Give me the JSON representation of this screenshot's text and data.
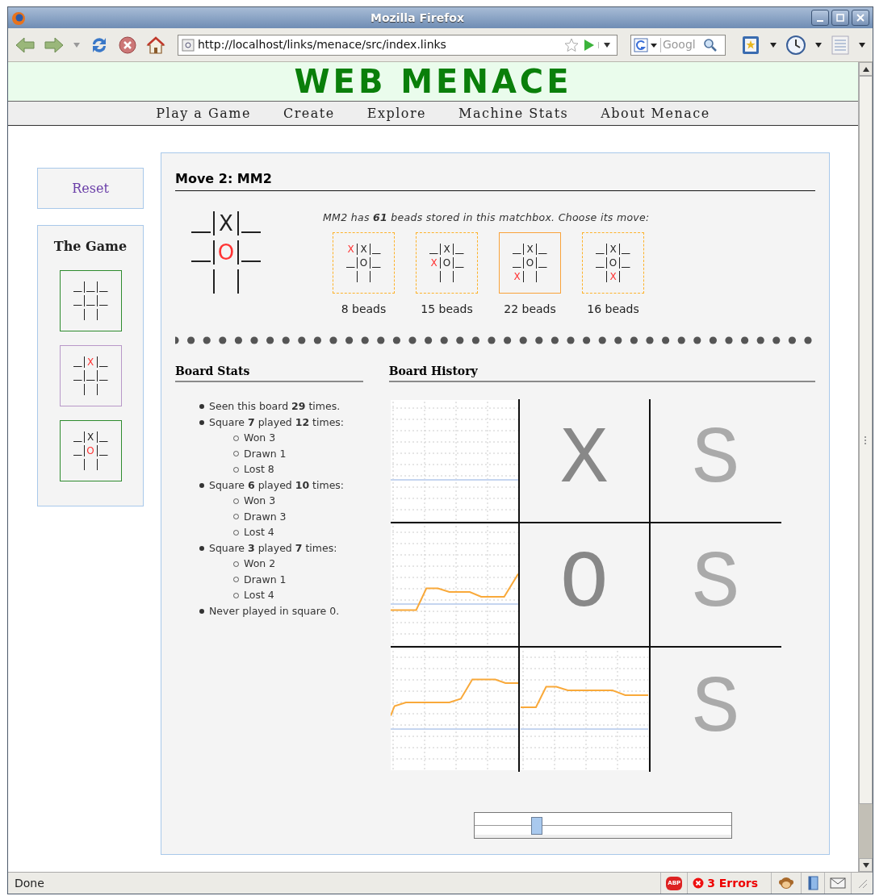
{
  "window": {
    "title": "Mozilla Firefox"
  },
  "toolbar": {
    "url": "http://localhost/links/menace/src/index.links",
    "search_placeholder": "Googl"
  },
  "page": {
    "site_title": "WEB MENACE",
    "menu": [
      "Play a Game",
      "Create",
      "Explore",
      "Machine Stats",
      "About Menace"
    ],
    "sidebar": {
      "reset_label": "Reset",
      "game_title": "The Game",
      "boards": [
        {
          "color": "#2e8b2e",
          "cells": [
            {
              "kind": "empty"
            },
            {
              "kind": "empty"
            },
            {
              "kind": "empty"
            },
            {
              "kind": "empty"
            },
            {
              "kind": "empty"
            },
            {
              "kind": "empty"
            },
            {
              "kind": "empty"
            },
            {
              "kind": "empty"
            },
            {
              "kind": "empty"
            }
          ]
        },
        {
          "color": "#b898c8",
          "cells": [
            {
              "kind": "empty"
            },
            {
              "kind": "mark",
              "mark": "X",
              "new": true
            },
            {
              "kind": "empty"
            },
            {
              "kind": "empty"
            },
            {
              "kind": "empty"
            },
            {
              "kind": "empty"
            },
            {
              "kind": "empty"
            },
            {
              "kind": "empty"
            },
            {
              "kind": "empty"
            }
          ]
        },
        {
          "color": "#2e8b2e",
          "cells": [
            {
              "kind": "empty"
            },
            {
              "kind": "mark",
              "mark": "X",
              "new": false
            },
            {
              "kind": "empty"
            },
            {
              "kind": "empty"
            },
            {
              "kind": "mark",
              "mark": "O",
              "new": true
            },
            {
              "kind": "empty"
            },
            {
              "kind": "empty"
            },
            {
              "kind": "empty"
            },
            {
              "kind": "empty"
            }
          ]
        }
      ]
    },
    "move": {
      "title": "Move 2: MM2",
      "board": {
        "cells": [
          {
            "kind": "empty"
          },
          {
            "kind": "mark",
            "mark": "X",
            "new": false
          },
          {
            "kind": "empty"
          },
          {
            "kind": "empty"
          },
          {
            "kind": "mark",
            "mark": "O",
            "new": true
          },
          {
            "kind": "empty"
          },
          {
            "kind": "empty"
          },
          {
            "kind": "empty"
          },
          {
            "kind": "empty"
          }
        ]
      },
      "prompt": "MM2 has **61** beads stored in this matchbox. Choose its move:",
      "options": [
        {
          "selected": false,
          "beads": "8 beads",
          "cells": [
            {
              "kind": "mark",
              "mark": "X",
              "new": true
            },
            {
              "kind": "mark",
              "mark": "X",
              "new": false
            },
            {
              "kind": "empty"
            },
            {
              "kind": "empty"
            },
            {
              "kind": "mark",
              "mark": "O",
              "new": false
            },
            {
              "kind": "empty"
            },
            {
              "kind": "empty"
            },
            {
              "kind": "empty"
            },
            {
              "kind": "empty"
            }
          ]
        },
        {
          "selected": false,
          "beads": "15 beads",
          "cells": [
            {
              "kind": "empty"
            },
            {
              "kind": "mark",
              "mark": "X",
              "new": false
            },
            {
              "kind": "empty"
            },
            {
              "kind": "mark",
              "mark": "X",
              "new": true
            },
            {
              "kind": "mark",
              "mark": "O",
              "new": false
            },
            {
              "kind": "empty"
            },
            {
              "kind": "empty"
            },
            {
              "kind": "empty"
            },
            {
              "kind": "empty"
            }
          ]
        },
        {
          "selected": true,
          "beads": "22 beads",
          "cells": [
            {
              "kind": "empty"
            },
            {
              "kind": "mark",
              "mark": "X",
              "new": false
            },
            {
              "kind": "empty"
            },
            {
              "kind": "empty"
            },
            {
              "kind": "mark",
              "mark": "O",
              "new": false
            },
            {
              "kind": "empty"
            },
            {
              "kind": "mark",
              "mark": "X",
              "new": true
            },
            {
              "kind": "empty"
            },
            {
              "kind": "empty"
            }
          ]
        },
        {
          "selected": false,
          "beads": "16 beads",
          "cells": [
            {
              "kind": "empty"
            },
            {
              "kind": "mark",
              "mark": "X",
              "new": false
            },
            {
              "kind": "empty"
            },
            {
              "kind": "empty"
            },
            {
              "kind": "mark",
              "mark": "O",
              "new": false
            },
            {
              "kind": "empty"
            },
            {
              "kind": "empty"
            },
            {
              "kind": "mark",
              "mark": "X",
              "new": true
            },
            {
              "kind": "empty"
            }
          ]
        }
      ]
    },
    "board_stats": {
      "title": "Board Stats",
      "items": [
        {
          "text": "Seen this board **29** times."
        },
        {
          "text": "Square **7** played **12** times:",
          "children": [
            {
              "text": "Won 3"
            },
            {
              "text": "Drawn 1"
            },
            {
              "text": "Lost 8"
            }
          ]
        },
        {
          "text": "Square **6** played **10** times:",
          "children": [
            {
              "text": "Won 3"
            },
            {
              "text": "Drawn 3"
            },
            {
              "text": "Lost 4"
            }
          ]
        },
        {
          "text": "Square **3** played **7** times:",
          "children": [
            {
              "text": "Won 2"
            },
            {
              "text": "Drawn 1"
            },
            {
              "text": "Lost 4"
            }
          ]
        },
        {
          "text": "Never played in square 0."
        }
      ]
    },
    "board_history": {
      "title": "Board History",
      "cells": [
        {
          "kind": "sparkline"
        },
        {
          "kind": "played",
          "text": "X"
        },
        {
          "kind": "open",
          "text": "S"
        },
        {
          "kind": "sparkline"
        },
        {
          "kind": "played",
          "text": "O"
        },
        {
          "kind": "open",
          "text": "S"
        },
        {
          "kind": "sparkline"
        },
        {
          "kind": "sparkline"
        },
        {
          "kind": "open",
          "text": "S"
        }
      ]
    },
    "slider": {
      "level": 0.23
    }
  },
  "status_bar": {
    "text": "Done",
    "adblock_label": "ABP",
    "errors": "3 Errors"
  }
}
